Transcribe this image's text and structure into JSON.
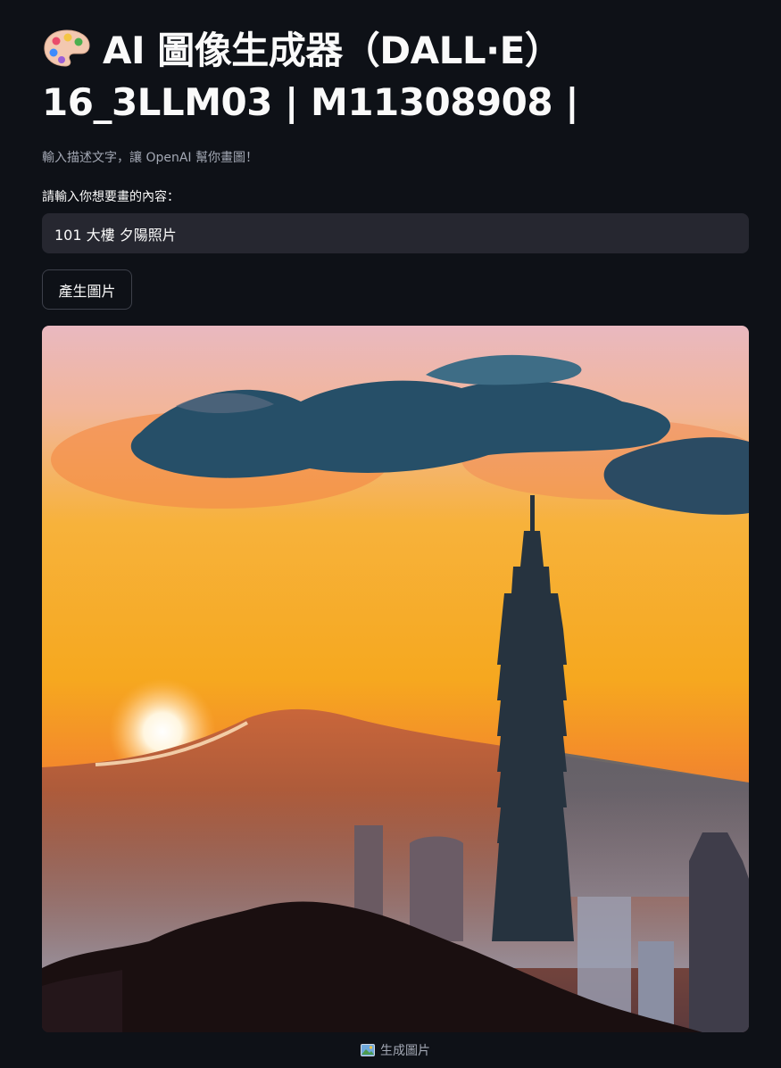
{
  "header": {
    "title_emoji": "palette-icon",
    "title": "AI 圖像生成器（DALL·E）16_3LLM03 | M11308908 |",
    "subtitle": "輸入描述文字，讓 OpenAI 幫你畫圖！"
  },
  "prompt": {
    "label": "請輸入你想要畫的內容：",
    "value": "101 大樓 夕陽照片"
  },
  "generate_button": {
    "label": "產生圖片"
  },
  "result": {
    "image_icon": "picture-icon",
    "caption": "生成圖片"
  },
  "colors": {
    "background": "#0e1117",
    "input_background": "#262730",
    "text": "#fafafa",
    "muted_text": "#a3a8b4"
  }
}
